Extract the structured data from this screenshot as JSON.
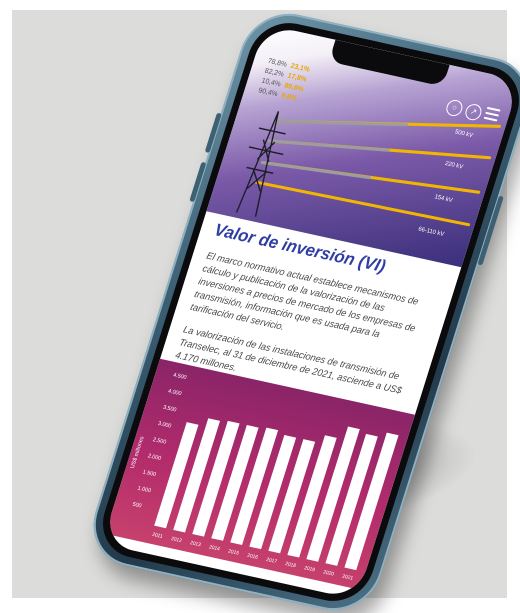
{
  "hero": {
    "stats": [
      {
        "pct": "78,8%",
        "hl": "23,1%"
      },
      {
        "pct": "82,2%",
        "hl": "17,8%"
      },
      {
        "pct": "10,4%",
        "hl": "89,6%"
      },
      {
        "pct": "90,4%",
        "hl": "9,6%"
      }
    ],
    "voltages": [
      "500 kV",
      "220 kV",
      "154 kV",
      "66-110 kV"
    ]
  },
  "article": {
    "title": "Valor de inversión (VI)",
    "paragraph1": "El marco normativo actual establece mecanismos de cálculo y publicación de la valorización de las inversiones a precios de mercado de los empresas de transmisión, información que es usada para la tarificación del servicio.",
    "paragraph2": "La valorización de las instalaciones de transmisión de Transelec, al 31 de diciembre de 2021, asciende a US$ 4.170 millones."
  },
  "colors": {
    "background": "#dcdcdb",
    "accent": "#2f3ea3",
    "chart": "#b32c6c",
    "highlight": "#e9a700"
  },
  "chart_data": {
    "type": "bar",
    "ylabel": "US$ millones",
    "ylim": [
      0,
      4500
    ],
    "yticks": [
      "500",
      "1.000",
      "1.500",
      "2.000",
      "2.500",
      "3.000",
      "3.500",
      "4.000",
      "4.500"
    ],
    "categories": [
      "2011",
      "2012",
      "2013",
      "2014",
      "2015",
      "2016",
      "2017",
      "2018",
      "2019",
      "2020",
      "2021"
    ],
    "values": [
      3200,
      3450,
      3500,
      3500,
      3550,
      3450,
      3450,
      3700,
      4100,
      4000,
      4170
    ]
  }
}
